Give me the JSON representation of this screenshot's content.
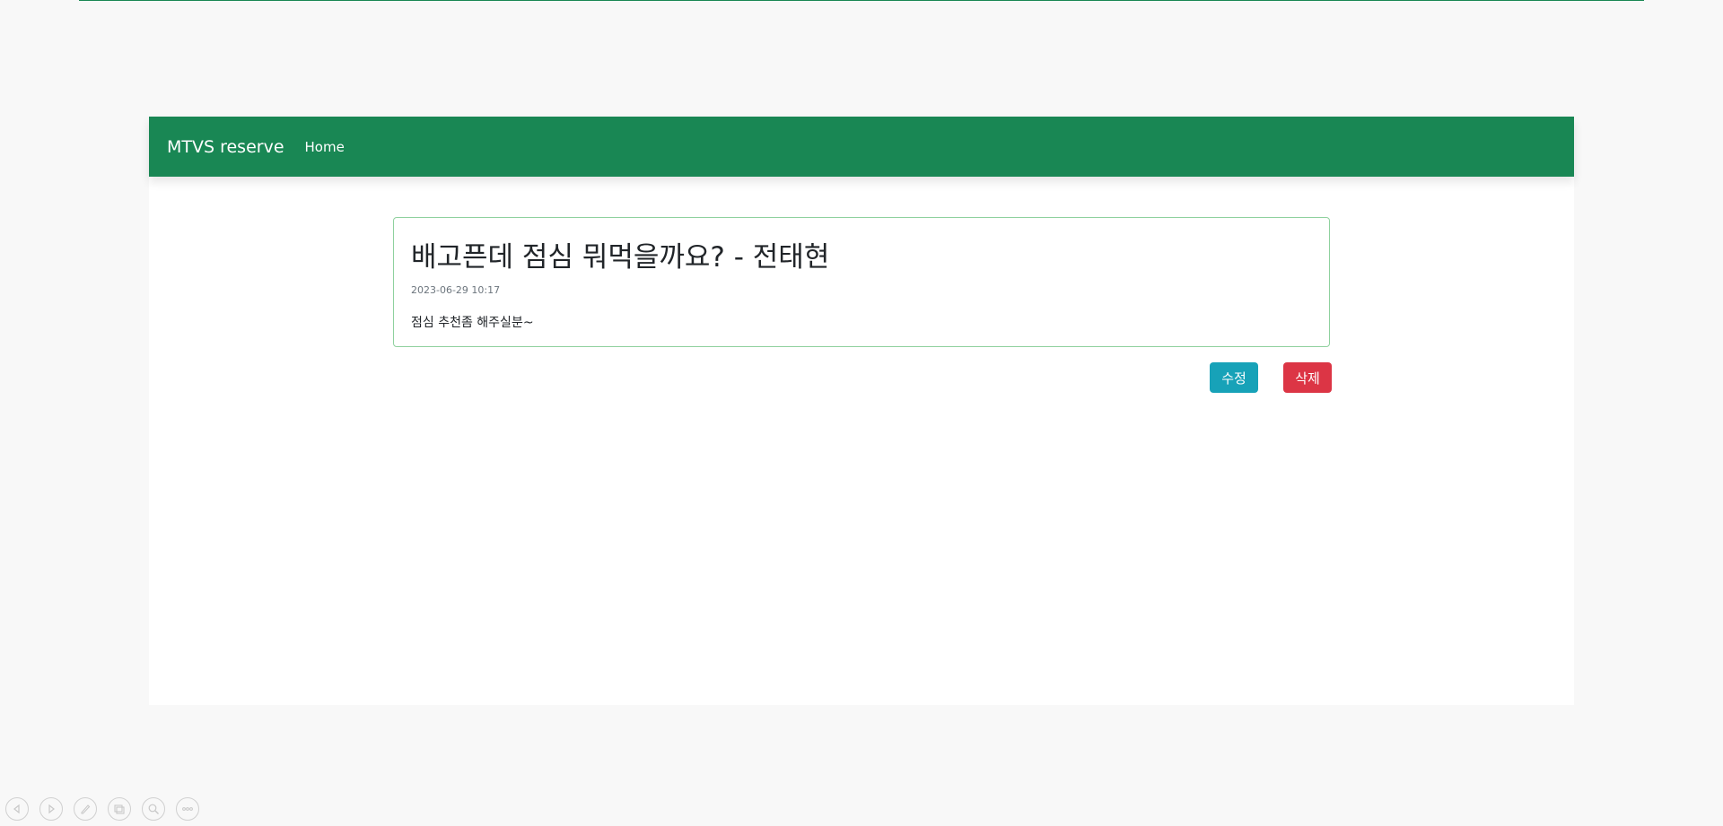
{
  "navbar": {
    "brand": "MTVS reserve",
    "home_link": "Home"
  },
  "post": {
    "title": "배고픈데 점심 뭐먹을까요? - 전태현",
    "date": "2023-06-29 10:17",
    "body": "점심 추천좀 해주실분~"
  },
  "actions": {
    "edit_label": "수정",
    "delete_label": "삭제"
  },
  "colors": {
    "navbar": "#198754",
    "edit_button": "#17a2b8",
    "delete_button": "#dc3545",
    "card_border": "#8fd19e"
  },
  "slide_controls": [
    {
      "icon": "previous-icon"
    },
    {
      "icon": "next-icon"
    },
    {
      "icon": "pen-icon"
    },
    {
      "icon": "slides-icon"
    },
    {
      "icon": "zoom-icon"
    },
    {
      "icon": "more-icon"
    }
  ]
}
